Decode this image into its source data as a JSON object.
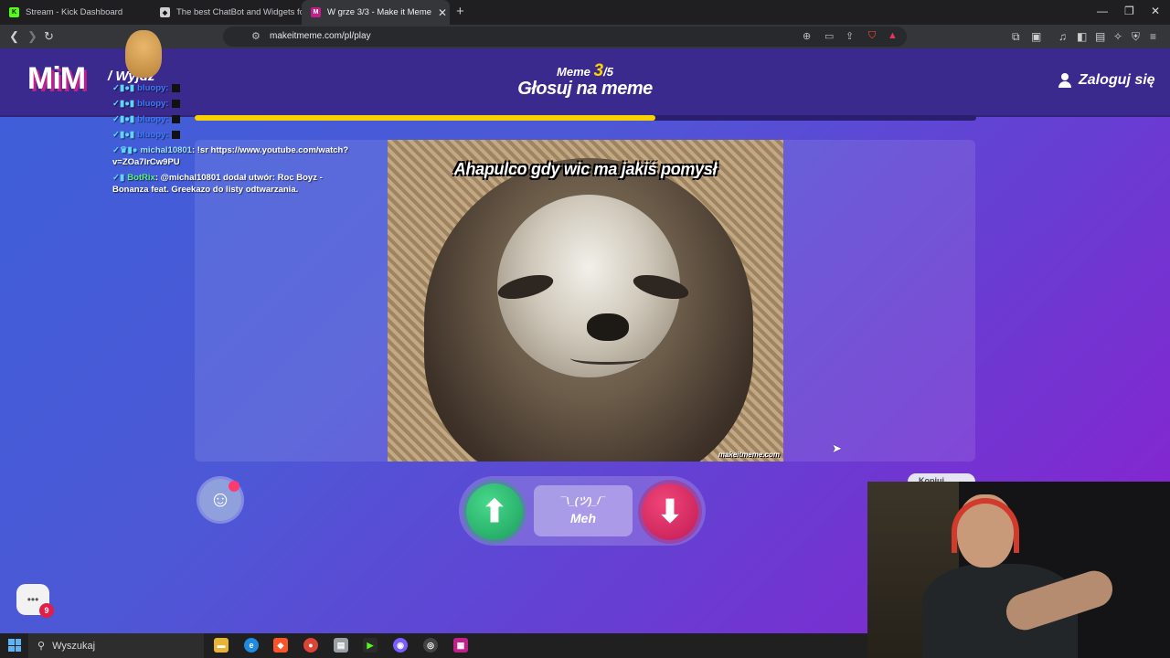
{
  "browser": {
    "tabs": [
      {
        "title": "Stream - Kick Dashboard",
        "favicon": "kick-icon",
        "color": "#53fc18"
      },
      {
        "title": "The best ChatBot and Widgets fo",
        "favicon": "botrix-icon",
        "color": "#cfcfcf"
      },
      {
        "title": "W grze 3/3 - Make it Meme",
        "favicon": "mim-icon",
        "color": "#c0208a"
      }
    ],
    "url": "makeitmeme.com/pl/play",
    "new_tab_label": "+",
    "window_controls": [
      "—",
      "❐",
      "✕"
    ]
  },
  "site": {
    "logo": "MiM",
    "exit_label": "/ Wyjdź",
    "counter_prefix": "Meme",
    "counter_current": "3",
    "counter_total": "/5",
    "title": "Głosuj na meme",
    "login_label": "Zaloguj się",
    "progress": 0.59,
    "accent": "#f7d100"
  },
  "meme": {
    "caption": "Ahapulco gdy wic ma jakiś pomysł",
    "watermark": "makeitmeme.com"
  },
  "vote": {
    "up_icon": "arrow-up-icon",
    "down_icon": "arrow-down-icon",
    "meh_face": "¯\\_(ツ)_/¯",
    "meh_label": "Meh"
  },
  "extra": {
    "copy_label": "Kopiuj",
    "chat_badge": "9"
  },
  "chat": [
    {
      "user": "bluopy:",
      "text": ""
    },
    {
      "user": "bluopy:",
      "text": ""
    },
    {
      "user": "bluopy:",
      "text": ""
    },
    {
      "user": "bluopy:",
      "text": ""
    },
    {
      "user": "michal10801",
      "text": ": !sr https://www.youtube.com/watch?v=ZOa7lrCw9PU"
    },
    {
      "user": "BotRix",
      "text": ": @michal10801 dodał utwór: Roc Boyz - Bonanza feat. Greekazo do listy odtwarzania."
    }
  ],
  "taskbar": {
    "search_placeholder": "Wyszukaj"
  }
}
